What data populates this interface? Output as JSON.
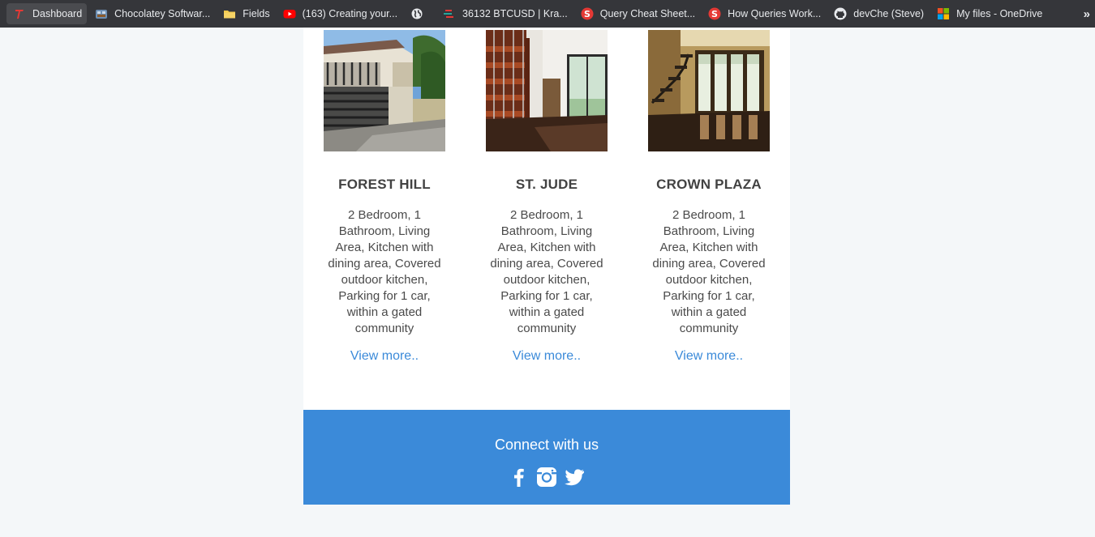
{
  "bookmarks": [
    {
      "label": "Dashboard",
      "icon": "t-logo-icon"
    },
    {
      "label": "Chocolatey Softwar...",
      "icon": "chocolatey-icon"
    },
    {
      "label": "Fields",
      "icon": "folder-icon"
    },
    {
      "label": "(163) Creating your...",
      "icon": "youtube-icon"
    },
    {
      "label": "",
      "icon": "globe-icon"
    },
    {
      "label": "36132 BTCUSD | Kra...",
      "icon": "kraken-chart-icon"
    },
    {
      "label": "Query Cheat Sheet...",
      "icon": "s-circle-icon"
    },
    {
      "label": "How Queries Work...",
      "icon": "s-circle-icon"
    },
    {
      "label": "devChe (Steve)",
      "icon": "github-icon"
    },
    {
      "label": "My files - OneDrive",
      "icon": "microsoft-icon"
    }
  ],
  "bookmarks_more": "»",
  "listings": [
    {
      "title": "FOREST HILL",
      "description": "2 Bedroom, 1 Bathroom, Living Area, Kitchen with dining area, Covered outdoor kitchen, Parking for 1 car, within a gated community",
      "link": "View more.."
    },
    {
      "title": "ST. JUDE",
      "description": "2 Bedroom, 1 Bathroom, Living Area, Kitchen with dining area, Covered outdoor kitchen, Parking for 1 car, within a gated community",
      "link": "View more.."
    },
    {
      "title": "CROWN PLAZA",
      "description": "2 Bedroom, 1 Bathroom, Living Area, Kitchen with dining area, Covered outdoor kitchen, Parking for 1 car, within a gated community",
      "link": "View more.."
    }
  ],
  "footer": {
    "title": "Connect with us",
    "socials": [
      "facebook-icon",
      "instagram-icon",
      "twitter-icon"
    ]
  },
  "colors": {
    "accent": "#3b8ad9",
    "bookmark_bar": "#35363a",
    "page_background": "#f4f7f9"
  }
}
